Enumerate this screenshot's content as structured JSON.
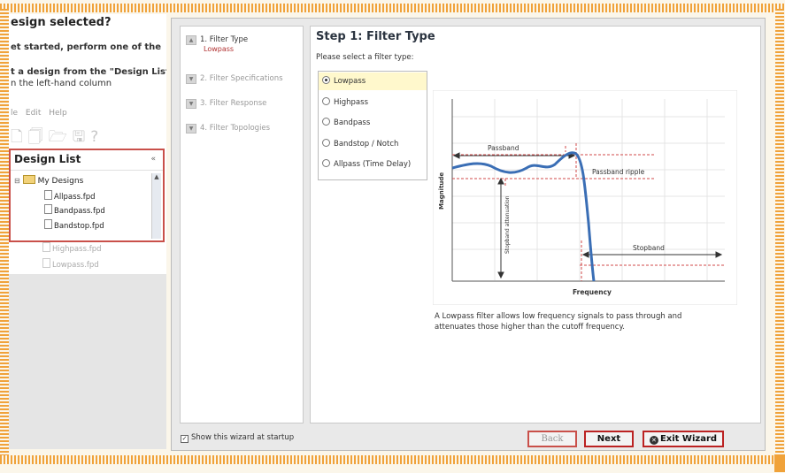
{
  "left_panel": {
    "title": "esign selected?",
    "line1": "et started, perform one of the",
    "line2": "t a design from the \"Design List\"",
    "line3": "n the left-hand column",
    "menu": [
      "le",
      "Edit",
      "Help"
    ],
    "design_list": {
      "title": "Design List",
      "collapse": "«",
      "root": "My Designs",
      "items": [
        "Allpass.fpd",
        "Bandpass.fpd",
        "Bandstop.fpd",
        "Highpass.fpd",
        "Lowpass.fpd"
      ]
    }
  },
  "wizard": {
    "steps": [
      {
        "label": "1. Filter Type",
        "sub": "Lowpass"
      },
      {
        "label": "2. Filter Specifications"
      },
      {
        "label": "3. Filter Response"
      },
      {
        "label": "4. Filter Topologies"
      }
    ],
    "title": "Step 1: Filter Type",
    "prompt": "Please select a filter type:",
    "options": [
      "Lowpass",
      "Highpass",
      "Bandpass",
      "Bandstop / Notch",
      "Allpass (Time Delay)"
    ],
    "selected_option": "Lowpass",
    "graph": {
      "passband": "Passband",
      "passband_ripple": "Passband ripple",
      "stopband": "Stopband",
      "stopband_attenuation": "Stopband attenuation",
      "y_label": "Magnitude",
      "x_label": "Frequency",
      "curve_color": "#3a6eb5"
    },
    "description": "A Lowpass filter allows low frequency signals to pass through and attenuates those higher than the cutoff frequency.",
    "show_at_startup": "Show this wizard at startup",
    "buttons": {
      "back": "Back",
      "next": "Next",
      "exit": "Exit Wizard"
    }
  }
}
